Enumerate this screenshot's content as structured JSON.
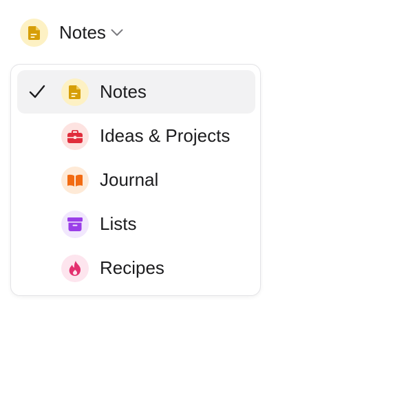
{
  "trigger": {
    "label": "Notes",
    "icon": "document-icon",
    "icon_bg": "#fdf1c4",
    "icon_color": "#d69e08"
  },
  "menu": {
    "selected_index": 0,
    "items": [
      {
        "label": "Notes",
        "icon": "document-icon",
        "icon_bg": "#fdf1c4",
        "icon_color": "#d69e08"
      },
      {
        "label": "Ideas & Projects",
        "icon": "briefcase-icon",
        "icon_bg": "#fde3e1",
        "icon_color": "#e02d3c"
      },
      {
        "label": "Journal",
        "icon": "book-icon",
        "icon_bg": "#feead7",
        "icon_color": "#f26b12"
      },
      {
        "label": "Lists",
        "icon": "archive-box-icon",
        "icon_bg": "#f1e7fd",
        "icon_color": "#9a3ee8"
      },
      {
        "label": "Recipes",
        "icon": "flame-icon",
        "icon_bg": "#fde5ee",
        "icon_color": "#e3306f"
      }
    ]
  }
}
